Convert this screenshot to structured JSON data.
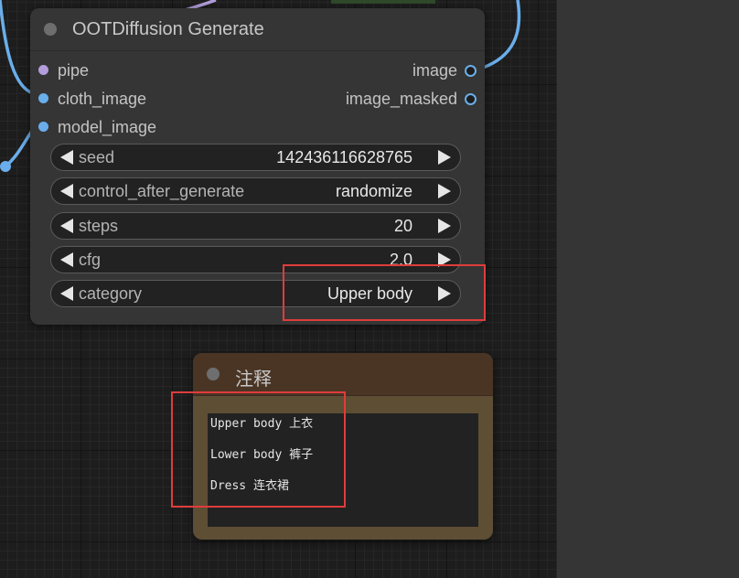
{
  "colors": {
    "canvas_bg": "#1d1d1d",
    "node_bg": "#353535",
    "note_bg": "#5e4e34",
    "note_header": "#4a3525",
    "wire_blue": "#6aaeeb",
    "wire_purple": "#b39ddb",
    "highlight_red": "#e03c3c"
  },
  "generate_node": {
    "title": "OOTDiffusion Generate",
    "inputs": [
      {
        "label": "pipe",
        "type_color": "#b39ddb"
      },
      {
        "label": "cloth_image",
        "type_color": "#6aaeeb"
      },
      {
        "label": "model_image",
        "type_color": "#6aaeeb"
      }
    ],
    "outputs": [
      {
        "label": "image",
        "type_color": "#6aaeeb"
      },
      {
        "label": "image_masked",
        "type_color": "#6aaeeb"
      }
    ],
    "widgets": [
      {
        "label": "seed",
        "value": "142436116628765"
      },
      {
        "label": "control_after_generate",
        "value": "randomize"
      },
      {
        "label": "steps",
        "value": "20"
      },
      {
        "label": "cfg",
        "value": "2.0"
      },
      {
        "label": "category",
        "value": "Upper body"
      }
    ]
  },
  "note_node": {
    "title": "注释",
    "lines": [
      "Upper body 上衣",
      "Lower body 裤子",
      "Dress 连衣裙"
    ]
  }
}
